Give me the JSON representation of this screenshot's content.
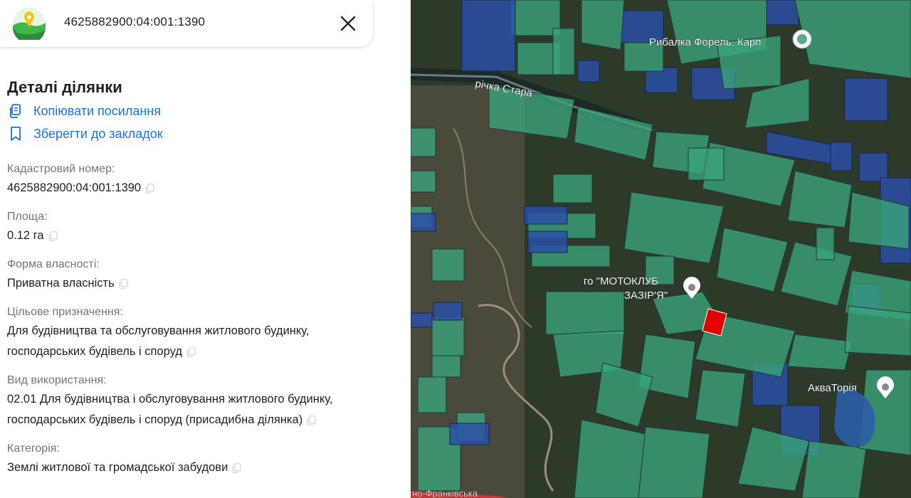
{
  "search": {
    "value": "4625882900:04:001:1390"
  },
  "details": {
    "title": "Деталі ділянки",
    "actions": [
      {
        "label": "Копіювати посилання",
        "icon": "copy-link-icon"
      },
      {
        "label": "Зберегти до закладок",
        "icon": "bookmark-icon"
      }
    ],
    "fields": [
      {
        "label": "Кадастровий номер:",
        "value": "4625882900:04:001:1390"
      },
      {
        "label": "Площа:",
        "value": "0.12 га"
      },
      {
        "label": "Форма власності:",
        "value": "Приватна власність"
      },
      {
        "label": "Цільове призначення:",
        "value": "Для будівництва та обслуговування житлового будинку, господарських будівель і споруд"
      },
      {
        "label": "Вид використання:",
        "value": "02.01 Для будівництва і обслуговування житлового будинку, господарських будівель і споруд (присадибна ділянка)"
      },
      {
        "label": "Категорія:",
        "value": "Землі житлової та громадської забудови"
      }
    ]
  },
  "map": {
    "labels": {
      "river": "річка Стара",
      "fishing": "Рибалка Форель, Карп",
      "club_line1": "го \"МОТОКЛУБ",
      "club_line2": "ЗАЗІР'Я\"",
      "aqua": "АкваТорія",
      "street": "но-Франківська"
    },
    "colors": {
      "parcel": "#3aa57a",
      "parcel_state": "#2a4fa8",
      "selected": "#e00000",
      "accent": "#1a73e8"
    }
  }
}
